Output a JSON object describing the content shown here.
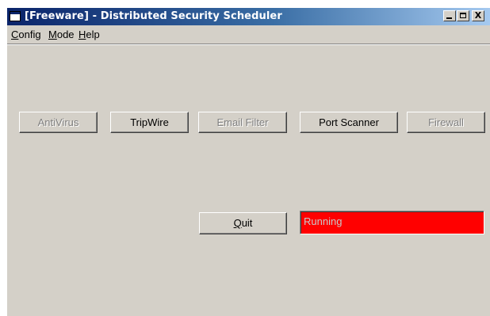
{
  "window": {
    "title": "[Freeware] - Distributed Security Scheduler",
    "controls": {
      "minimize": "minimize",
      "maximize": "maximize",
      "close": "X"
    }
  },
  "menu": {
    "config": {
      "mnemonic": "C",
      "rest": "onfig"
    },
    "mode": {
      "mnemonic": "M",
      "rest": "ode"
    },
    "help": {
      "mnemonic": "H",
      "rest": "elp"
    }
  },
  "modules": [
    {
      "label": "AntiVirus",
      "enabled": false
    },
    {
      "label": "TripWire",
      "enabled": true
    },
    {
      "label": "Email Filter",
      "enabled": false
    },
    {
      "label": "Port Scanner",
      "enabled": true
    },
    {
      "label": "Firewall",
      "enabled": false
    }
  ],
  "quit": {
    "mnemonic": "Q",
    "rest": "uit"
  },
  "status": {
    "text": "Running",
    "background": "#ff0000",
    "text_color": "#c8c8c8"
  },
  "colors": {
    "face": "#d4d0c8",
    "title_start": "#0a246a",
    "title_end": "#a6caf0",
    "disabled_text": "#808080"
  }
}
